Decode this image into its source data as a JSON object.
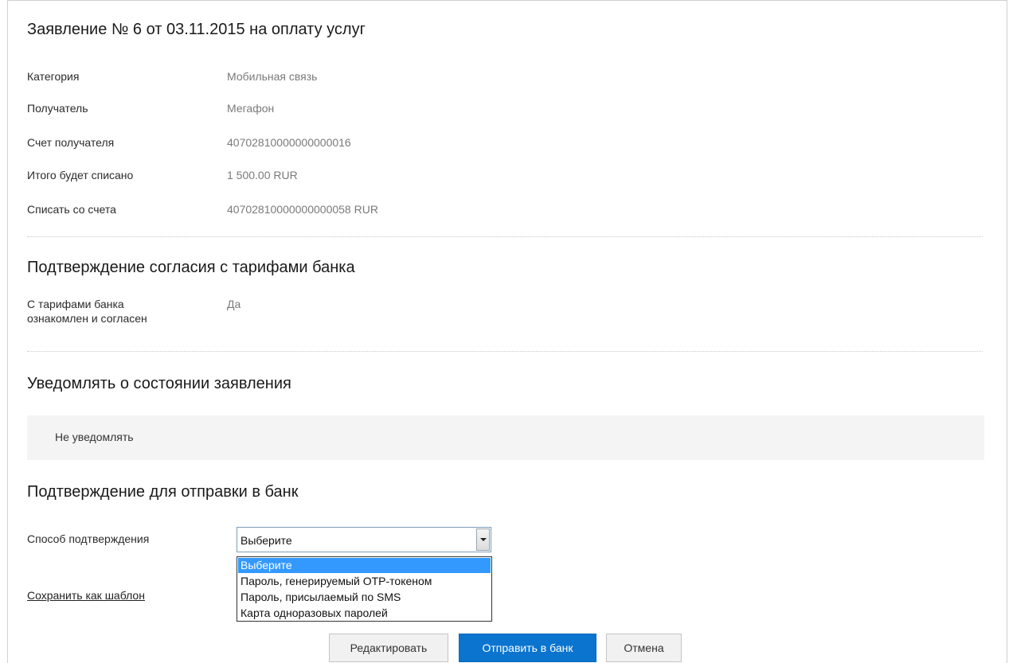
{
  "application": {
    "title": "Заявление № 6 от 03.11.2015 на оплату услуг",
    "fields": [
      {
        "label": "Категория",
        "value": "Мобильная связь"
      },
      {
        "label": "Получатель",
        "value": "Мегафон"
      },
      {
        "label": "Счет получателя",
        "value": "40702810000000000016"
      },
      {
        "label": "Итого будет списано",
        "value": "1 500.00 RUR"
      },
      {
        "label": "Списать со счета",
        "value": "40702810000000000058 RUR"
      }
    ]
  },
  "tariffs": {
    "title": "Подтверждение согласия с тарифами банка",
    "label_line1": "С тарифами банка",
    "label_line2": "ознакомлен и согласен",
    "value": "Да"
  },
  "notify": {
    "title": "Уведомлять о состоянии заявления",
    "value": "Не уведомлять"
  },
  "confirm": {
    "title": "Подтверждение для отправки в банк",
    "method_label": "Способ подтверждения",
    "selected": "Выберите",
    "options": [
      "Выберите",
      "Пароль, генерируемый OTP-токеном",
      "Пароль, присылаемый по SMS",
      "Карта одноразовых паролей"
    ]
  },
  "save_template_label": "Сохранить как шаблон",
  "buttons": {
    "edit": "Редактировать",
    "send": "Отправить в банк",
    "cancel": "Отмена"
  },
  "colors": {
    "primary": "#0a74cf",
    "selected_option": "#3399ff"
  }
}
